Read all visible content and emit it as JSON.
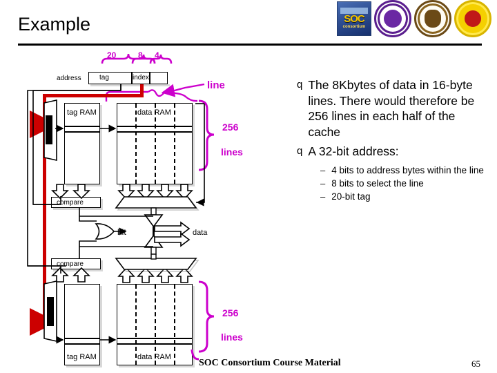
{
  "slide": {
    "title": "Example",
    "footer": "SOC Consortium Course Material",
    "page_number": "65"
  },
  "logos": [
    {
      "name": "soc-consortium-logo",
      "word": "SOC",
      "sub": "consortium"
    },
    {
      "name": "purple-seal-logo"
    },
    {
      "name": "brown-seal-logo"
    },
    {
      "name": "yellow-seal-logo"
    }
  ],
  "diagram": {
    "address": {
      "label": "address",
      "fields": [
        {
          "name": "tag",
          "label": "tag",
          "bits": "20"
        },
        {
          "name": "index",
          "label": "index",
          "bits": "8"
        },
        {
          "name": "offset",
          "label": "",
          "bits": "4"
        }
      ]
    },
    "callouts": {
      "line": "line",
      "count_top": "256",
      "count_top_unit": "lines",
      "count_bottom": "256",
      "count_bottom_unit": "lines"
    },
    "way_top": {
      "decode": "decode",
      "tag_ram": "tag RAM",
      "data_ram": "data RAM",
      "compare": "compare",
      "mux": "mux"
    },
    "way_bottom": {
      "decode": "decode",
      "tag_ram": "tag RAM",
      "data_ram": "data RAM",
      "compare": "compare",
      "mux": "mux"
    },
    "outputs": {
      "hit": "hit",
      "data": "data"
    }
  },
  "bullets": [
    {
      "marker": "q",
      "text": "The 8Kbytes of data in 16-byte lines. There would therefore be 256 lines in each half of the cache",
      "level": 1
    },
    {
      "marker": "q",
      "text": "A 32-bit address:",
      "level": 1
    },
    {
      "marker": "–",
      "text": "4 bits to address bytes within the line",
      "level": 2
    },
    {
      "marker": "–",
      "text": "8 bits to select the line",
      "level": 2
    },
    {
      "marker": "–",
      "text": "20-bit tag",
      "level": 2
    }
  ],
  "colors": {
    "magenta": "#cc00cc",
    "red": "#cc0000",
    "black": "#000000"
  }
}
